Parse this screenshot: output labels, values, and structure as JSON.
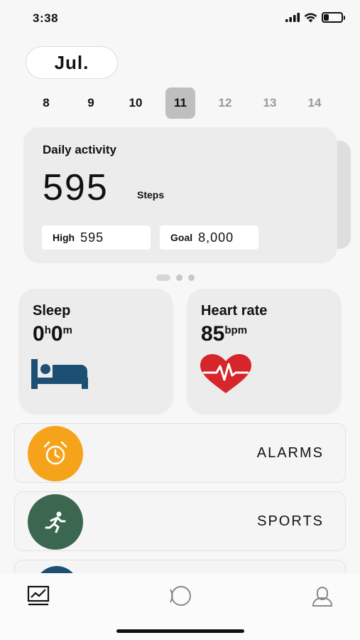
{
  "status_bar": {
    "time": "3:38",
    "battery": "28",
    "battery_level": 0.28
  },
  "month": "Jul.",
  "dates": [
    {
      "day": "8",
      "state": "past"
    },
    {
      "day": "9",
      "state": "past"
    },
    {
      "day": "10",
      "state": "past"
    },
    {
      "day": "11",
      "state": "selected"
    },
    {
      "day": "12",
      "state": "future"
    },
    {
      "day": "13",
      "state": "future"
    },
    {
      "day": "14",
      "state": "future"
    }
  ],
  "activity": {
    "title": "Daily activity",
    "steps": "595",
    "unit": "Steps",
    "high_label": "High",
    "high_value": "595",
    "goal_label": "Goal",
    "goal_value": "8,000"
  },
  "carousel": {
    "pages": 3,
    "active": 0
  },
  "sleep": {
    "title": "Sleep",
    "hours": "0",
    "hours_unit": "h",
    "minutes": "0",
    "minutes_unit": "m",
    "icon": "bed-icon",
    "icon_color": "#1d4e73"
  },
  "heart": {
    "title": "Heart rate",
    "value": "85",
    "unit": "bpm",
    "icon": "heart-pulse-icon",
    "icon_color": "#d7262b"
  },
  "list": [
    {
      "label": "ALARMS",
      "icon": "alarm-clock-icon",
      "color": "#f5a31a"
    },
    {
      "label": "SPORTS",
      "icon": "runner-icon",
      "color": "#3b6650"
    }
  ],
  "tabs": [
    {
      "name": "activity",
      "icon": "chart-icon"
    },
    {
      "name": "device",
      "icon": "watch-icon"
    },
    {
      "name": "profile",
      "icon": "profile-icon"
    }
  ]
}
